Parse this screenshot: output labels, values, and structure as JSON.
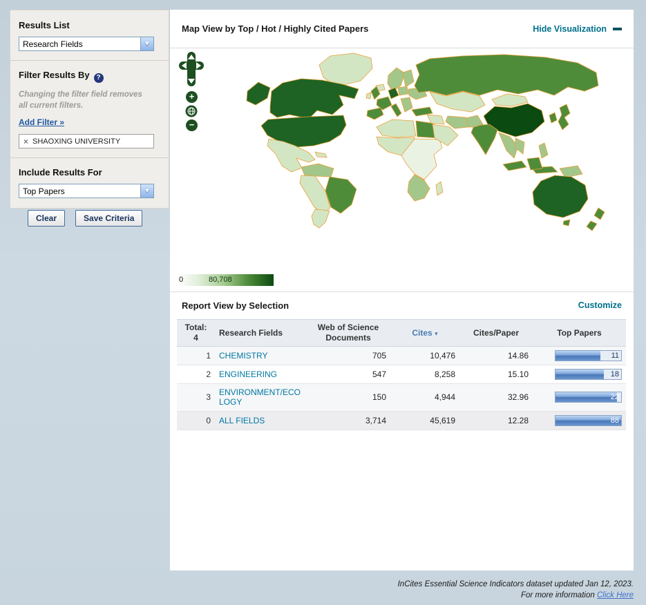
{
  "colors": {
    "accent_teal": "#00708c",
    "link_blue": "#1f57a4",
    "field_link": "#0077a2",
    "sort_link": "#4a7ab5",
    "map_border": "#ea9f35",
    "button_green": "#1d4f21",
    "btn_border": "#46699c"
  },
  "icons": {
    "dropdown_arrow": "▼",
    "sort_arrow": "▾",
    "help": "?",
    "close": "×"
  },
  "sidebar": {
    "results_list": {
      "label": "Results List",
      "value": "Research Fields"
    },
    "filter": {
      "label": "Filter Results By",
      "note_line1": "Changing the filter field removes",
      "note_line2": "all current filters.",
      "add_filter": "Add Filter »",
      "chip": {
        "label": "SHAOXING UNIVERSITY"
      }
    },
    "include": {
      "label": "Include Results For",
      "value": "Top Papers"
    },
    "buttons": {
      "clear": "Clear",
      "save": "Save Criteria"
    }
  },
  "map": {
    "title": "Map View by Top / Hot / Highly Cited Papers",
    "hide_link": "Hide Visualization",
    "legend": {
      "min": "0",
      "max": "80,708"
    },
    "controls": {
      "zoom_in": "+",
      "zoom_out": "−"
    }
  },
  "report": {
    "title": "Report View by Selection",
    "customize": "Customize",
    "header": {
      "total_label": "Total:",
      "total_value": "4",
      "col_field": "Research Fields",
      "col_docs_line1": "Web of Science",
      "col_docs_line2": "Documents",
      "col_cites": "Cites",
      "col_cpp": "Cites/Paper",
      "col_top": "Top Papers"
    },
    "rows": [
      {
        "rank": "1",
        "field": "CHEMISTRY",
        "documents": "705",
        "cites": "10,476",
        "cites_per_paper": "14.86",
        "top_papers": "11",
        "bar_fraction": 0.68,
        "bar_text_light": false,
        "summary": false
      },
      {
        "rank": "2",
        "field": "ENGINEERING",
        "documents": "547",
        "cites": "8,258",
        "cites_per_paper": "15.10",
        "top_papers": "18",
        "bar_fraction": 0.74,
        "bar_text_light": false,
        "summary": false
      },
      {
        "rank": "3",
        "field": "ENVIRONMENT/ECOLOGY",
        "documents": "150",
        "cites": "4,944",
        "cites_per_paper": "32.96",
        "top_papers": "22",
        "bar_fraction": 0.94,
        "bar_text_light": true,
        "summary": false
      },
      {
        "rank": "0",
        "field": "ALL FIELDS",
        "documents": "3,714",
        "cites": "45,619",
        "cites_per_paper": "12.28",
        "top_papers": "88",
        "bar_fraction": 1.0,
        "bar_text_light": true,
        "summary": true
      }
    ]
  },
  "footer": {
    "line1": "InCites Essential Science Indicators dataset updated Jan 12, 2023.",
    "line2_prefix": "For more information ",
    "line2_link": "Click Here"
  }
}
